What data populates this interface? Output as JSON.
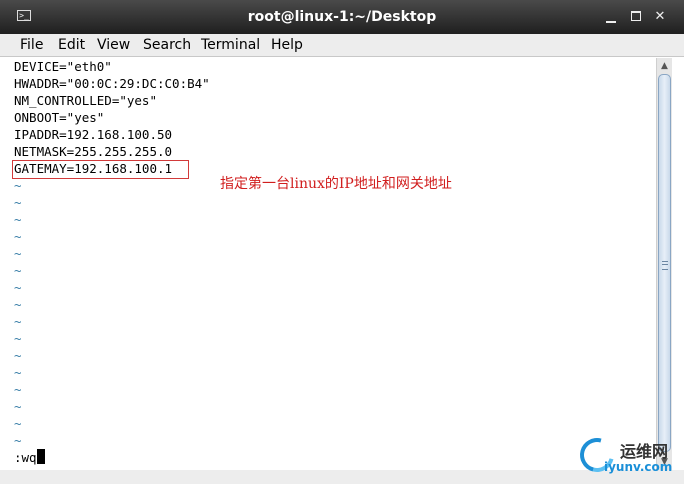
{
  "window": {
    "title": "root@linux-1:~/Desktop",
    "icon": "terminal-icon",
    "controls": [
      "minimize-icon",
      "maximize-icon",
      "close-icon"
    ]
  },
  "menu": [
    "File",
    "Edit",
    "View",
    "Search",
    "Terminal",
    "Help"
  ],
  "editor": {
    "lines": [
      "DEVICE=\"eth0\"",
      "HWADDR=\"00:0C:29:DC:C0:B4\"",
      "NM_CONTROLLED=\"yes\"",
      "ONBOOT=\"yes\"",
      "IPADDR=192.168.100.50",
      "NETMASK=255.255.255.0",
      "GATEMAY=192.168.100.1"
    ],
    "tilde": "~",
    "command": ":wq"
  },
  "annotation": "指定第一台linux的IP地址和网关地址",
  "highlight_color": "#d23a3a",
  "watermark": {
    "text": "运维网",
    "url": "iyunv.com"
  }
}
